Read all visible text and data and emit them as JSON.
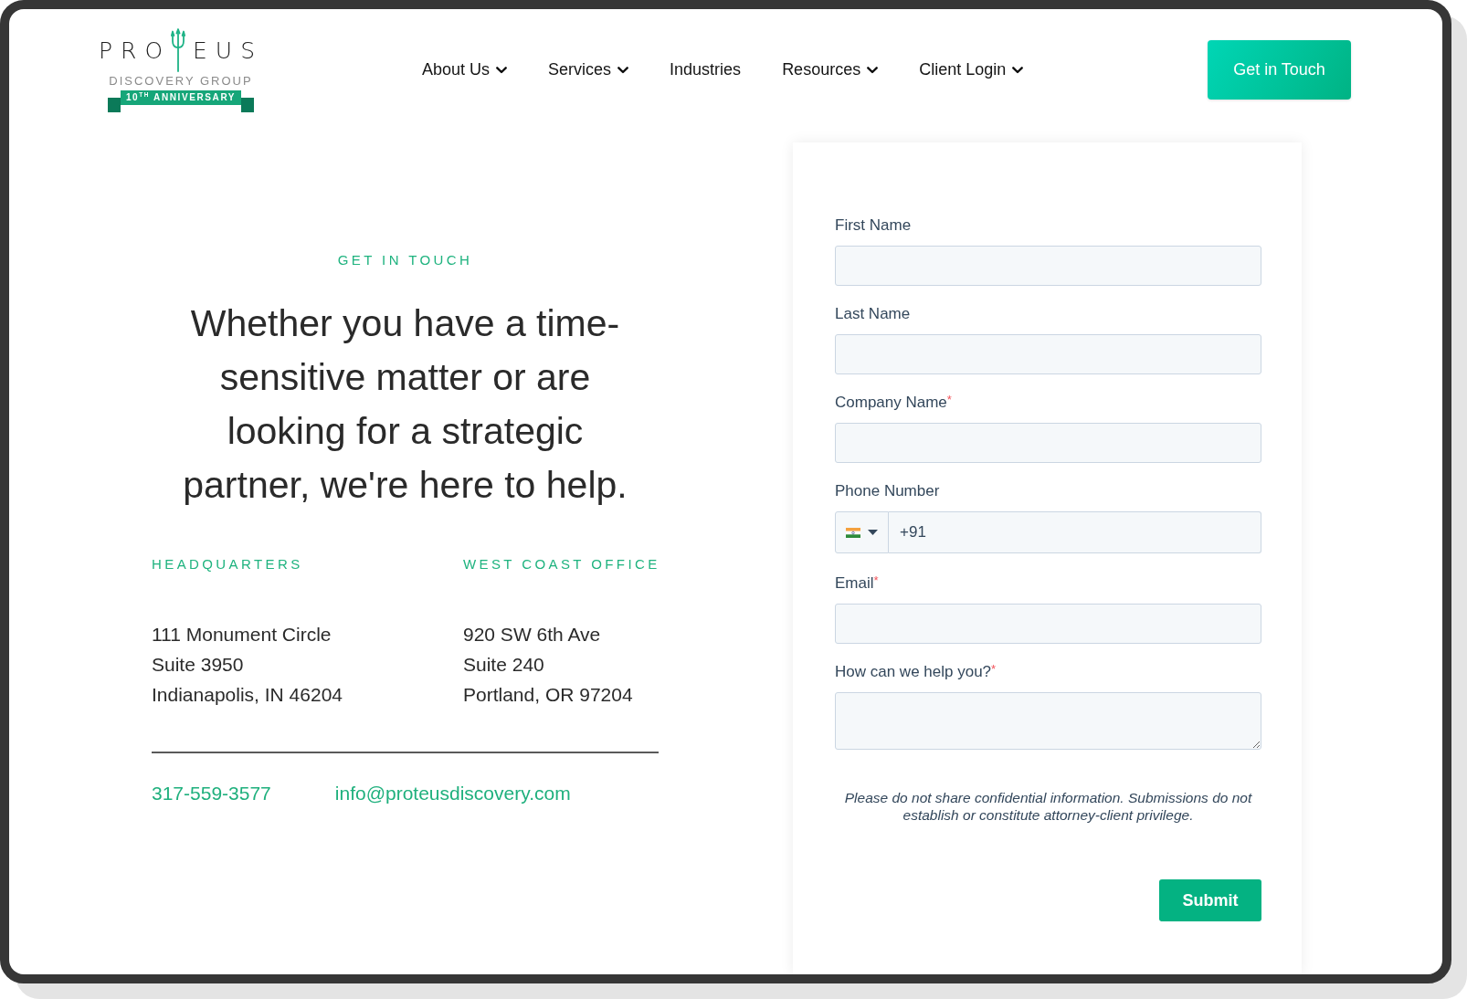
{
  "logo": {
    "wordmark_start": "PRO",
    "wordmark_end": "EUS",
    "tagline": "DISCOVERY GROUP",
    "ribbon": "10$^{TH}$ ANNIVERSARY"
  },
  "nav": [
    {
      "label": "About Us",
      "has_menu": true
    },
    {
      "label": "Services",
      "has_menu": true
    },
    {
      "label": "Industries",
      "has_menu": false
    },
    {
      "label": "Resources",
      "has_menu": true
    },
    {
      "label": "Client Login",
      "has_menu": true
    }
  ],
  "header_button": "Get in Touch",
  "contact": {
    "eyebrow": "GET IN TOUCH",
    "headline": "Whether you have a time-sensitive matter or are looking for a strategic partner, we're here to help.",
    "offices": [
      {
        "title": "HEADQUARTERS",
        "lines": [
          "111 Monument Circle",
          "Suite 3950",
          "Indianapolis, IN 46204"
        ]
      },
      {
        "title": "WEST COAST OFFICE",
        "lines": [
          "920 SW 6th Ave",
          "Suite 240",
          "Portland, OR 97204"
        ]
      }
    ],
    "phone": "317-559-3577",
    "email": "info@proteusdiscovery.com"
  },
  "form": {
    "fields": [
      {
        "kind": "text",
        "label": "First Name"
      },
      {
        "kind": "text",
        "label": "Last Name"
      },
      {
        "kind": "text",
        "label": "Company Name",
        "required_mark": "*"
      },
      {
        "kind": "phone",
        "label": "Phone Number",
        "value": "+91"
      },
      {
        "kind": "text",
        "label": "Email",
        "required_mark": "*"
      },
      {
        "kind": "textarea",
        "label": "How can we help you?",
        "required_mark": "*"
      }
    ],
    "disclaimer": "Please do not share confidential information. Submissions do not establish or constitute attorney-client privilege.",
    "submit": "Submit"
  }
}
